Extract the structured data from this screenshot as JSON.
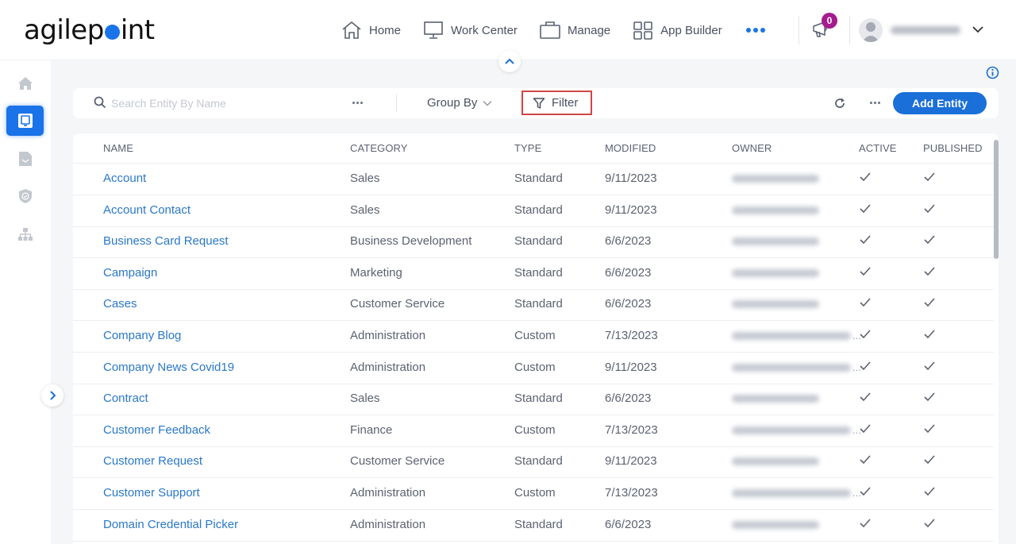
{
  "header": {
    "logo_text_left": "agilep",
    "logo_text_right": "int",
    "nav": [
      {
        "label": "Home",
        "icon": "home-icon"
      },
      {
        "label": "Work Center",
        "icon": "monitor-icon"
      },
      {
        "label": "Manage",
        "icon": "briefcase-icon"
      },
      {
        "label": "App Builder",
        "icon": "grid-icon"
      }
    ],
    "more_icon": "more-horizontal-icon",
    "notification_count": "0",
    "accent_color": "#1a73e8",
    "badge_color": "#a51c8e"
  },
  "sidebar": {
    "items": [
      {
        "name": "home",
        "icon": "home-icon",
        "active": false
      },
      {
        "name": "entities",
        "icon": "monitor-icon",
        "active": true
      },
      {
        "name": "documents",
        "icon": "document-icon",
        "active": false
      },
      {
        "name": "security",
        "icon": "shield-icon",
        "active": false
      },
      {
        "name": "hierarchy",
        "icon": "org-chart-icon",
        "active": false
      }
    ]
  },
  "toolbar": {
    "search_placeholder": "Search Entity By Name",
    "search_value": "",
    "group_by_label": "Group By",
    "filter_label": "Filter",
    "add_label": "Add Entity",
    "filter_highlight_color": "#d04545"
  },
  "table": {
    "columns": [
      "NAME",
      "CATEGORY",
      "TYPE",
      "MODIFIED",
      "OWNER",
      "ACTIVE",
      "PUBLISHED"
    ],
    "rows": [
      {
        "name": "Account",
        "category": "Sales",
        "type": "Standard",
        "modified": "9/11/2023",
        "owner_long": false,
        "active": true,
        "published": true
      },
      {
        "name": "Account Contact",
        "category": "Sales",
        "type": "Standard",
        "modified": "9/11/2023",
        "owner_long": false,
        "active": true,
        "published": true
      },
      {
        "name": "Business Card Request",
        "category": "Business Development",
        "type": "Standard",
        "modified": "6/6/2023",
        "owner_long": false,
        "active": true,
        "published": true
      },
      {
        "name": "Campaign",
        "category": "Marketing",
        "type": "Standard",
        "modified": "6/6/2023",
        "owner_long": false,
        "active": true,
        "published": true
      },
      {
        "name": "Cases",
        "category": "Customer Service",
        "type": "Standard",
        "modified": "6/6/2023",
        "owner_long": false,
        "active": true,
        "published": true
      },
      {
        "name": "Company Blog",
        "category": "Administration",
        "type": "Custom",
        "modified": "7/13/2023",
        "owner_long": true,
        "active": true,
        "published": true
      },
      {
        "name": "Company News Covid19",
        "category": "Administration",
        "type": "Custom",
        "modified": "9/11/2023",
        "owner_long": true,
        "active": true,
        "published": true
      },
      {
        "name": "Contract",
        "category": "Sales",
        "type": "Standard",
        "modified": "6/6/2023",
        "owner_long": false,
        "active": true,
        "published": true
      },
      {
        "name": "Customer Feedback",
        "category": "Finance",
        "type": "Custom",
        "modified": "7/13/2023",
        "owner_long": true,
        "active": true,
        "published": true
      },
      {
        "name": "Customer Request",
        "category": "Customer Service",
        "type": "Standard",
        "modified": "9/11/2023",
        "owner_long": false,
        "active": true,
        "published": true
      },
      {
        "name": "Customer Support",
        "category": "Administration",
        "type": "Custom",
        "modified": "7/13/2023",
        "owner_long": true,
        "active": true,
        "published": true
      },
      {
        "name": "Domain Credential Picker",
        "category": "Administration",
        "type": "Standard",
        "modified": "6/6/2023",
        "owner_long": false,
        "active": true,
        "published": true
      }
    ],
    "owner_truncation": "..."
  }
}
